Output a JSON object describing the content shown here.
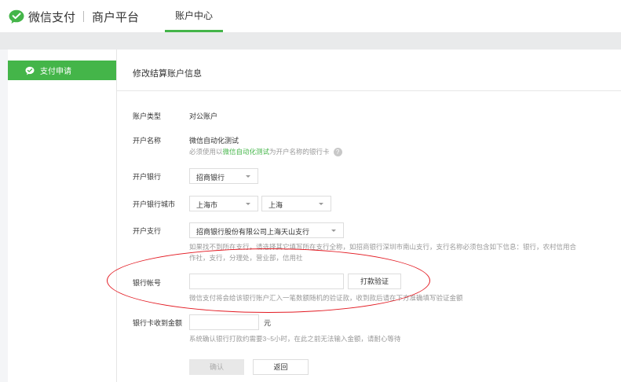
{
  "header": {
    "brand": "微信支付",
    "platform": "商户平台",
    "tab_account": "账户中心"
  },
  "sidebar": {
    "items": [
      {
        "label": "支付申请"
      }
    ]
  },
  "main": {
    "title": "修改结算账户信息",
    "form": {
      "account_type_label": "账户类型",
      "account_type_value": "对公账户",
      "account_name_label": "开户名称",
      "account_name_value": "微信自动化测试",
      "account_name_hint_prefix": "必须使用以",
      "account_name_hint_link": "微信自动化测试",
      "account_name_hint_suffix": "为开户名称的银行卡",
      "bank_label": "开户银行",
      "bank_value": "招商银行",
      "city_label": "开户银行城市",
      "province_value": "上海市",
      "city_value": "上海",
      "branch_label": "开户支行",
      "branch_value": "招商银行股份有限公司上海天山支行",
      "branch_hint_line1": "如果找不到所在支行，请选择其它填写所在支行全称，如招商银行深圳市南山支行，支行名称必须包含如下信息：银行，农村信用合",
      "branch_hint_line2": "作社，支行，分理处，营业部，信用社",
      "account_number_label": "银行帐号",
      "account_number_value": "",
      "verify_button": "打款验证",
      "account_number_hint": "微信支付将会给该银行账户汇入一笔数额随机的验证款，收到款后请在下方准确填写验证金额",
      "amount_label": "银行卡收到金额",
      "amount_value": "",
      "amount_unit": "元",
      "amount_hint": "系统确认银行打款约需要3~5小时，在此之前无法输入金额，请耐心等待",
      "confirm_button": "确认",
      "back_button": "返回"
    }
  },
  "colors": {
    "accent": "#44b549",
    "annotation": "#e31b23"
  },
  "icons": {
    "logo": "wechat-pay-logo-icon",
    "sidebar": "wechat-bubble-icon",
    "help": "question-icon",
    "dropdown": "caret-down-icon"
  }
}
